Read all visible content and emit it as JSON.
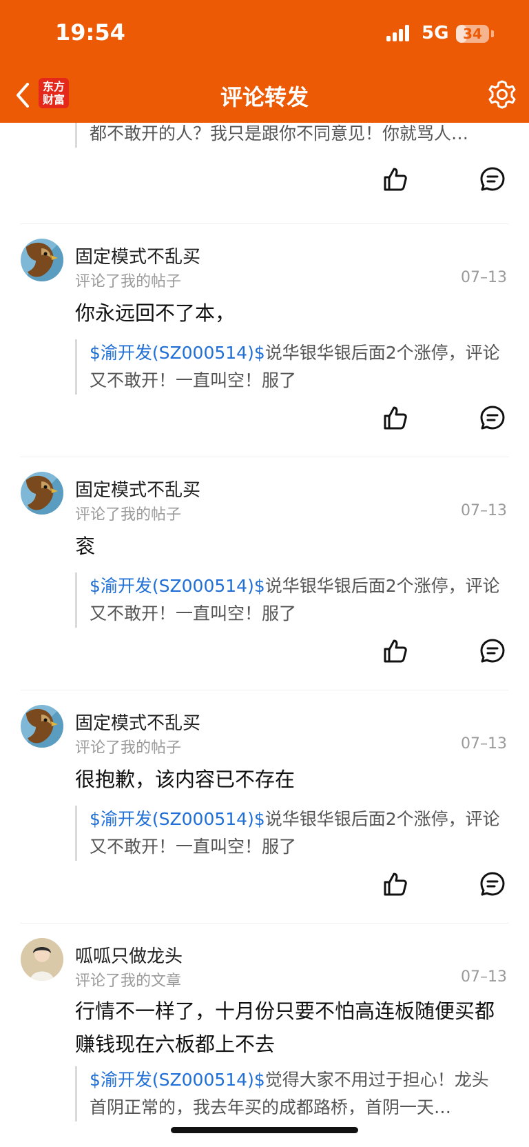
{
  "status_bar": {
    "time": "19:54",
    "network": "5G",
    "battery": "34",
    "battery_level": 0.34
  },
  "nav": {
    "title": "评论转发",
    "logo_text": "东方财富",
    "brand_color": "#ec5a06"
  },
  "top_item": {
    "quote_text": "都不敢开的人？我只是跟你不同意见！你就骂人…"
  },
  "items": [
    {
      "user": "固定模式不乱买",
      "action": "评论了我的帖子",
      "date": "07–13",
      "comment": "你永远回不了本，",
      "quote_link": "$渝开发(SZ000514)$",
      "quote_text": "说华银华银后面2个涨停，评论又不敢开！一直叫空！服了"
    },
    {
      "user": "固定模式不乱买",
      "action": "评论了我的帖子",
      "date": "07–13",
      "comment": "衮",
      "quote_link": "$渝开发(SZ000514)$",
      "quote_text": "说华银华银后面2个涨停，评论又不敢开！一直叫空！服了"
    },
    {
      "user": "固定模式不乱买",
      "action": "评论了我的帖子",
      "date": "07–13",
      "comment": "很抱歉，该内容已不存在",
      "quote_link": "$渝开发(SZ000514)$",
      "quote_text": "说华银华银后面2个涨停，评论又不敢开！一直叫空！服了"
    },
    {
      "user": "呱呱只做龙头",
      "action": "评论了我的文章",
      "date": "07–13",
      "comment": "行情不一样了，十月份只要不怕高连板随便买都赚钱现在六板都上不去",
      "quote_link": "$渝开发(SZ000514)$",
      "quote_text": "觉得大家不用过于担心！龙头首阴正常的，我去年买的成都路桥，首阴一天…"
    }
  ],
  "icons": {
    "like": "thumbs-up-icon",
    "reply": "comment-icon",
    "settings": "gear-icon",
    "back": "chevron-left-icon"
  }
}
